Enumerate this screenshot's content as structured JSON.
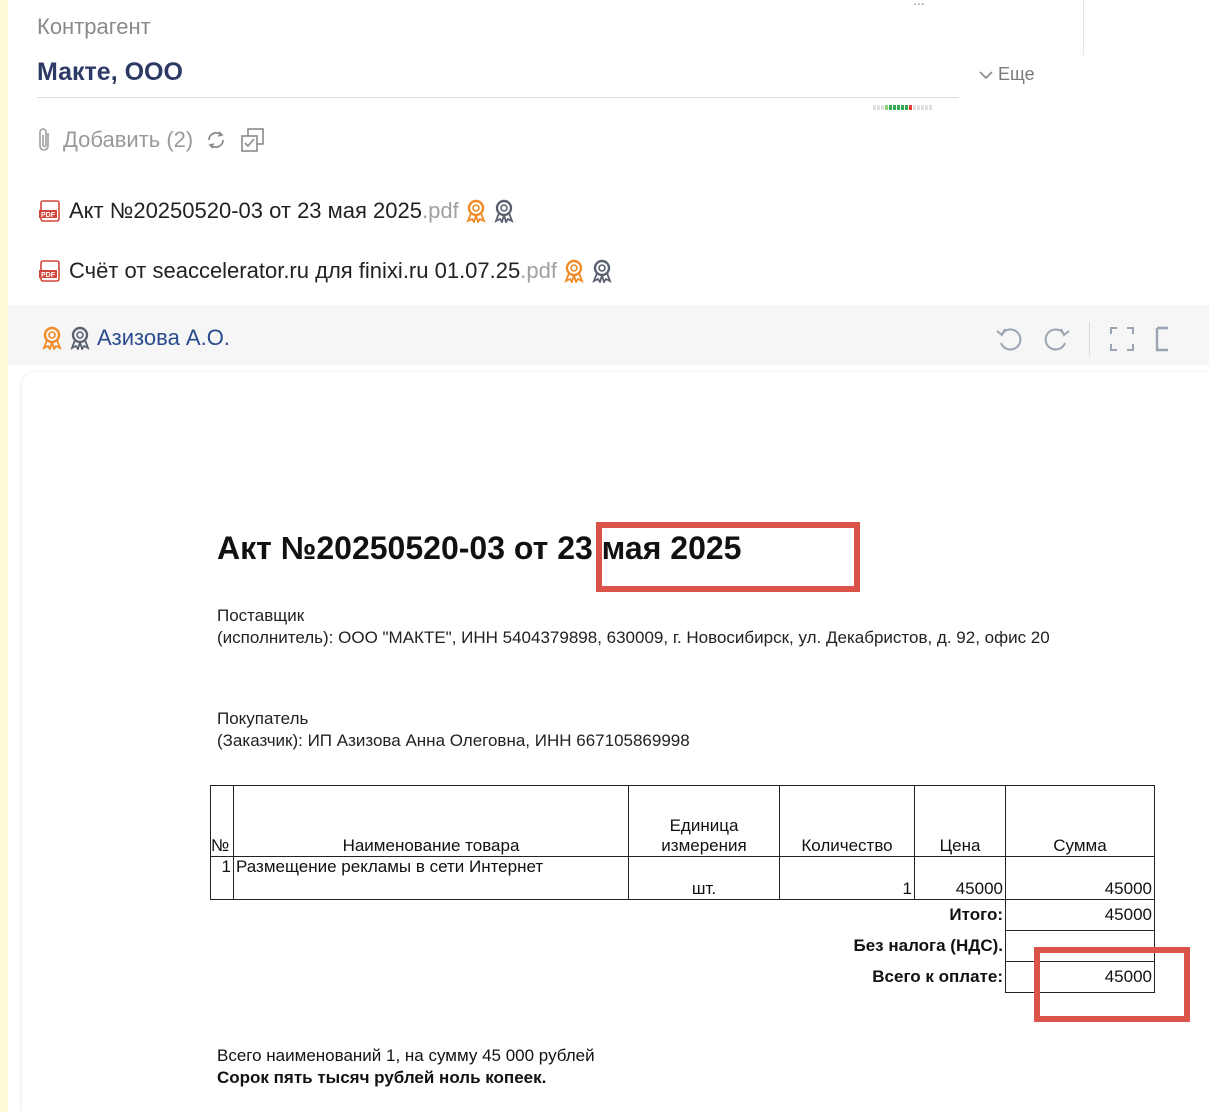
{
  "header": {
    "cut_text": "...",
    "counterparty_label": "Контрагент",
    "counterparty_name": "Макте, ООО",
    "more_label": "Еще"
  },
  "attachments": {
    "add_label": "Добавить (2)",
    "files": [
      {
        "name": "Акт №20250520-03 от 23 мая 2025",
        "ext": ".pdf"
      },
      {
        "name": "Счёт от seaccelerator.ru для finixi.ru 01.07.25",
        "ext": ".pdf"
      }
    ]
  },
  "signer": {
    "name": "Азизова А.О."
  },
  "colors": {
    "accent": "#d9534a",
    "link": "#2a4b8d",
    "badge_orange": "#f08a24",
    "badge_gray": "#5a6270"
  },
  "document": {
    "title": "Акт №20250520-03 от 23 мая 2025",
    "supplier_label": "Поставщик",
    "supplier_text": "(исполнитель): ООО \"МАКТЕ\", ИНН 5404379898, 630009, г. Новосибирск, ул. Декабристов, д. 92, офис 20",
    "buyer_label": "Покупатель",
    "buyer_text": "(Заказчик): ИП Азизова Анна Олеговна, ИНН 667105869998",
    "table": {
      "headers": [
        "№",
        "Наименование товара",
        "Единица измерения",
        "Количество",
        "Цена",
        "Сумма"
      ],
      "rows": [
        [
          "1",
          "Размещение рекламы в сети Интернет",
          "шт.",
          "1",
          "45000",
          "45000"
        ]
      ],
      "total_label": "Итого:",
      "total_value": "45000",
      "vat_label": "Без налога (НДС).",
      "vat_value": "",
      "grand_label": "Всего к оплате:",
      "grand_value": "45000"
    },
    "summary_line": "Всего наименований 1, на сумму 45 000 рублей",
    "summary_words": "Сорок пять тысяч рублей ноль копеек."
  }
}
